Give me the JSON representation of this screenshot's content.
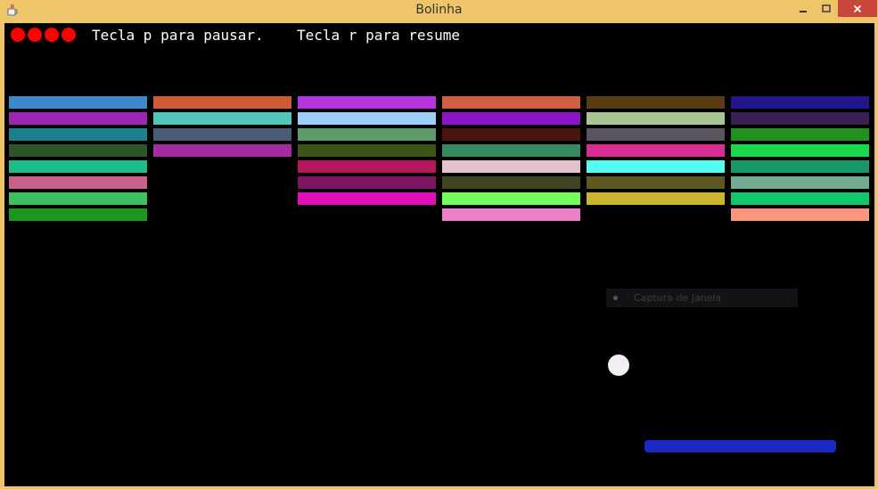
{
  "window": {
    "title": "Bolinha",
    "minimize_icon": "minimize-icon",
    "maximize_icon": "maximize-icon",
    "close_icon": "close-icon",
    "app_icon": "java-cup-icon"
  },
  "hud": {
    "lives_count": 4,
    "life_color": "#ff0000",
    "pause_text": "Tecla p para pausar.",
    "resume_text": "Tecla r para resume"
  },
  "bricks": {
    "columns": [
      [
        "#3f88c9",
        "#9c27b5",
        "#1b7f8e",
        "#2e5427",
        "#1dbd8b",
        "#c8628d",
        "#3dc062",
        "#1a971c"
      ],
      [
        "#cf5a37",
        "#52c7b9",
        "#4b5d76",
        "#a52ba0"
      ],
      [
        "#b435de",
        "#9ecdfb",
        "#5e9a6b",
        "#3c5416",
        "#b3175c",
        "#7c1561",
        "#e00fb9"
      ],
      [
        "#d05e41",
        "#8b16c7",
        "#4a1710",
        "#368b5e",
        "#e2c2ce",
        "#3f4523",
        "#72fe5d",
        "#eb81c7"
      ],
      [
        "#5b3b11",
        "#aac594",
        "#5c5561",
        "#d82e94",
        "#55fbf1",
        "#5d581f",
        "#cab52d"
      ],
      [
        "#22178a",
        "#3a2053",
        "#21911e",
        "#1ad84c",
        "#199766",
        "#71ac8f",
        "#12c66b",
        "#fa957e"
      ]
    ]
  },
  "ball": {
    "color": "#f4eef4"
  },
  "paddle": {
    "color": "#1a28c2"
  },
  "tooltip": {
    "label": "Captura de Janela"
  }
}
